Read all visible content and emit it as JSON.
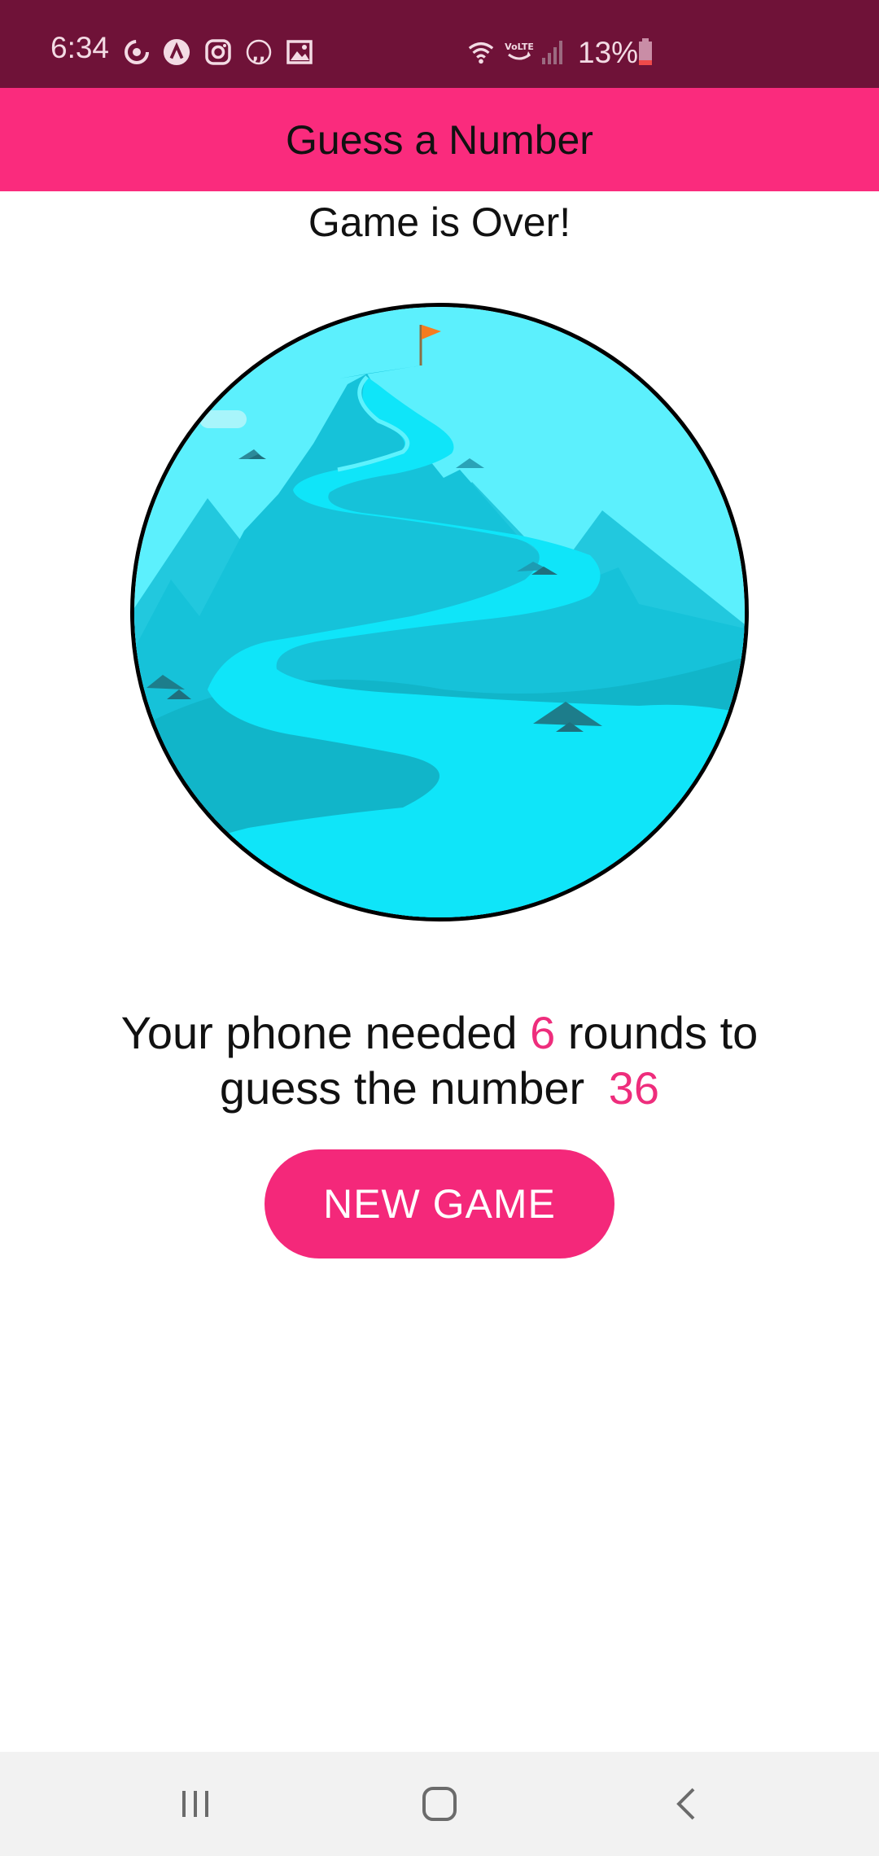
{
  "status_bar": {
    "time": "6:34",
    "battery_percent": "13%",
    "left_icons": [
      "sync-icon",
      "app-a-icon",
      "instagram-icon",
      "quote-icon",
      "gallery-icon"
    ],
    "right_icons": [
      "wifi-icon",
      "volte-icon",
      "signal-icon",
      "battery-icon"
    ],
    "volte_label": "VoLTE"
  },
  "header": {
    "title": "Guess a Number"
  },
  "main": {
    "title": "Game is Over!",
    "image": "mountain-summit-illustration",
    "result": {
      "prefix": "Your phone needed",
      "rounds": "6",
      "middle": "rounds to guess the number",
      "number": "36"
    },
    "new_game_label": "NEW GAME"
  },
  "colors": {
    "status_bar": "#6f1238",
    "header": "#fa2b7d",
    "accent": "#f4287a",
    "highlight": "#ee2d7c"
  },
  "nav_bar": {
    "buttons": [
      "recents-icon",
      "home-icon",
      "back-icon"
    ]
  }
}
